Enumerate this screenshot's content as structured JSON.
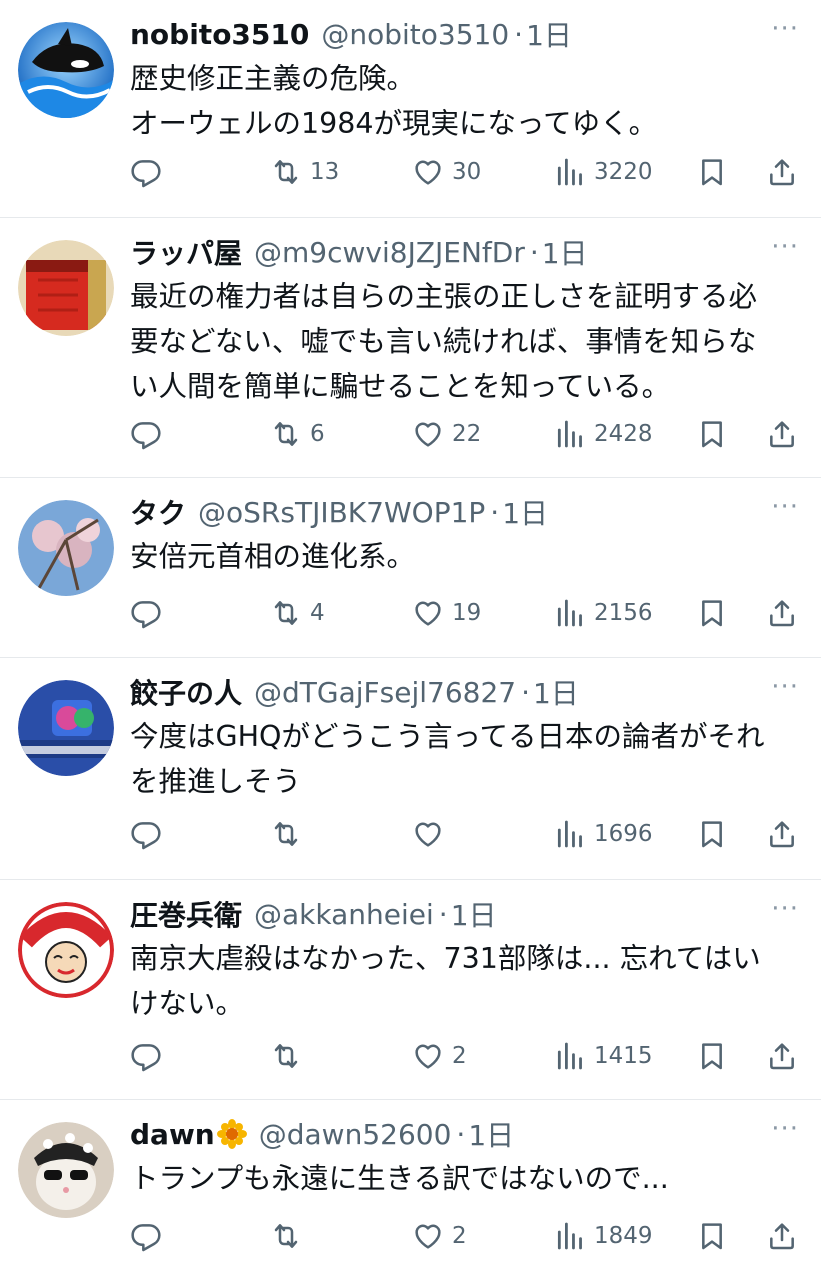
{
  "colors": {
    "text": "#0f1419",
    "secondary": "#536471",
    "divider": "#e6e9ec",
    "more": "#8b98a5"
  },
  "icons": {
    "reply": "reply-icon",
    "retweet": "retweet-icon",
    "like": "heart-icon",
    "views": "views-icon",
    "bookmark": "bookmark-icon",
    "share": "share-icon",
    "more": "more-icon"
  },
  "tweets": [
    {
      "name": "nobito3510",
      "handle": "@nobito3510",
      "sep": "·",
      "time": "1日",
      "more": "···",
      "text": "歴史修正主義の危険。\nオーウェルの1984が現実になってゆく。",
      "retweets": "13",
      "likes": "30",
      "views": "3220"
    },
    {
      "name": "ラッパ屋",
      "handle": "@m9cwvi8JZJENfDr",
      "sep": "·",
      "time": "1日",
      "more": "···",
      "text": "最近の権力者は自らの主張の正しさを証明する必\n要などない、嘘でも言い続ければ、事情を知らな\nい人間を簡単に騙せることを知っている。",
      "retweets": "6",
      "likes": "22",
      "views": "2428"
    },
    {
      "name": "タク",
      "handle": "@oSRsTJIBK7WOP1P",
      "sep": "·",
      "time": "1日",
      "more": "···",
      "text": "安倍元首相の進化系。",
      "retweets": "4",
      "likes": "19",
      "views": "2156"
    },
    {
      "name": "餃子の人",
      "handle": "@dTGajFsejl76827",
      "sep": "·",
      "time": "1日",
      "more": "···",
      "text": "今度はGHQがどうこう言ってる日本の論者がそれ\nを推進しそう",
      "retweets": "",
      "likes": "",
      "views": "1696"
    },
    {
      "name": "圧巻兵衛",
      "handle": "@akkanheiei",
      "sep": "·",
      "time": "1日",
      "more": "···",
      "text": "南京大虐殺はなかった、731部隊は... 忘れてはい\nけない。",
      "retweets": "",
      "likes": "2",
      "views": "1415"
    },
    {
      "name": "dawn",
      "handle": "@dawn52600",
      "sep": "·",
      "time": "1日",
      "more": "···",
      "text": "トランプも永遠に生きる訳ではないので...",
      "retweets": "",
      "likes": "2",
      "views": "1849"
    }
  ]
}
